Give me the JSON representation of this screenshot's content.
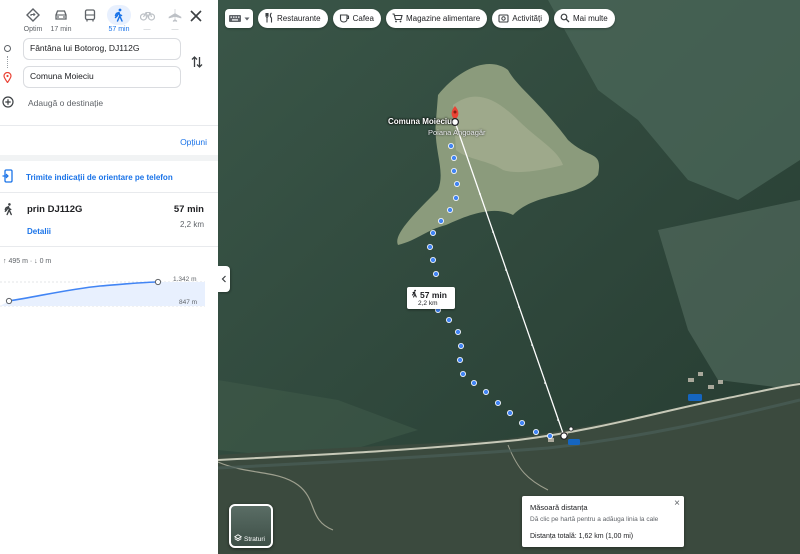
{
  "travel_modes": [
    {
      "name": "best-route",
      "label": "Optim",
      "icon": "diamond-route-icon"
    },
    {
      "name": "driving",
      "label": "17 min",
      "icon": "car-icon"
    },
    {
      "name": "transit",
      "label": "",
      "icon": "bus-icon"
    },
    {
      "name": "walking",
      "label": "57 min",
      "icon": "walking-icon",
      "active": true
    },
    {
      "name": "cycling",
      "label": "—",
      "icon": "bicycle-icon"
    },
    {
      "name": "flight",
      "label": "—",
      "icon": "plane-icon"
    }
  ],
  "directions": {
    "origin": "Fântâna lui Botorog, DJ112G",
    "destination": "Comuna Moieciu",
    "add_destination": "Adaugă o destinație",
    "options_label": "Opțiuni",
    "send_to_phone": "Trimite indicații de orientare pe telefon"
  },
  "route": {
    "via": "prin DJ112G",
    "duration": "57 min",
    "distance": "2,2 km",
    "details_link": "Detalii"
  },
  "elevation": {
    "gain_loss": "↑ 495 m · ↓ 0 m",
    "max": "1.342 m",
    "min": "847 m"
  },
  "map": {
    "chips": [
      {
        "label": "Restaurante",
        "icon": "fork-knife-icon"
      },
      {
        "label": "Cafea",
        "icon": "coffee-icon"
      },
      {
        "label": "Magazine alimentare",
        "icon": "cart-icon"
      },
      {
        "label": "Activități",
        "icon": "camera-ticket-icon"
      },
      {
        "label": "Mai multe",
        "icon": "search-icon"
      }
    ],
    "route_label_time": "57 min",
    "route_label_dist": "2,2 km",
    "place_name": "Comuna Moieciu",
    "place_name_2": "Poiana Angoagăr",
    "measure": {
      "title": "Măsoară distanța",
      "hint": "Dă clic pe hartă pentru a adăuga linia la cale",
      "total": "Distanța totală: 1,62 km (1,00 mi)"
    },
    "layers_label": "Straturi",
    "colors": {
      "route": "#4285f4",
      "accent": "#1a73e8",
      "destination_pin": "#ea4335"
    }
  }
}
